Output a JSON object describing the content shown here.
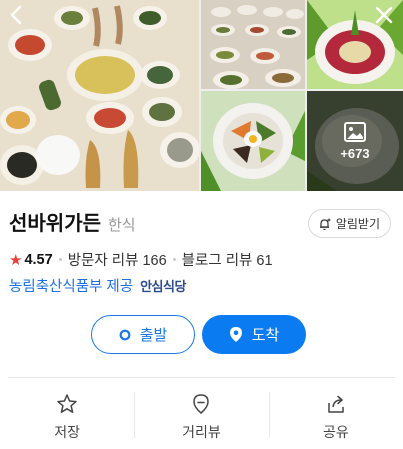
{
  "gallery": {
    "more_count": "+673",
    "icons": {
      "back": "chevron-left-icon",
      "close": "close-icon",
      "photo": "image-icon"
    }
  },
  "place": {
    "name": "선바위가든",
    "category": "한식",
    "alarm_label": "알림받기",
    "rating": "4.57",
    "visitor_reviews": "방문자 리뷰 166",
    "blog_reviews": "블로그 리뷰 61",
    "provider": "농림축산식품부 제공",
    "provider_badge": "안심식당"
  },
  "route": {
    "depart_label": "출발",
    "arrive_label": "도착"
  },
  "actions": {
    "save_label": "저장",
    "distance_label": "거리뷰",
    "share_label": "공유"
  },
  "colors": {
    "accent": "#0a7bf0",
    "star": "#e8403a",
    "provider": "#1d6fe6"
  }
}
